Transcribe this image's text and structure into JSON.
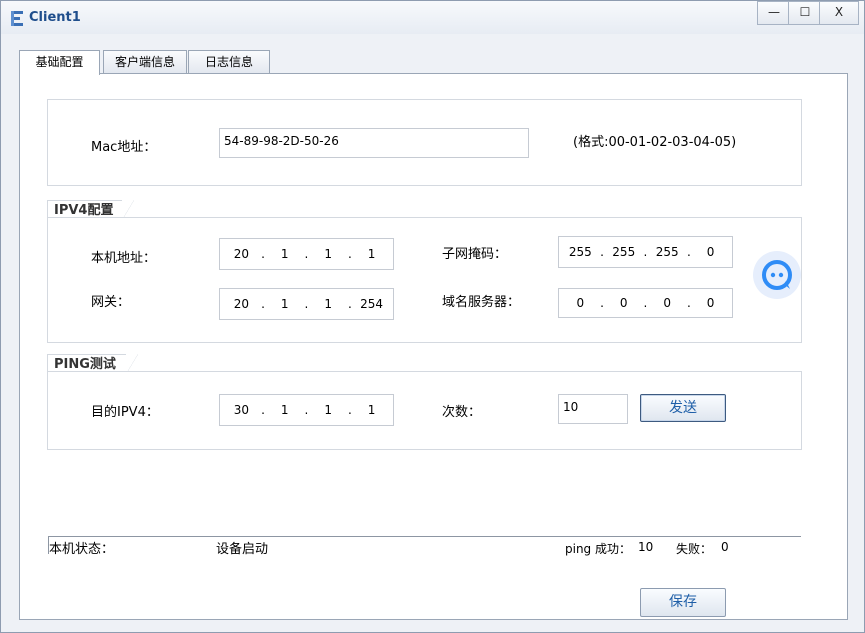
{
  "window": {
    "title": "Client1",
    "minimize": "—",
    "maximize": "☐",
    "close": "X"
  },
  "tabs": [
    "基础配置",
    "客户端信息",
    "日志信息"
  ],
  "mac": {
    "label": "Mac地址：",
    "value": "54-89-98-2D-50-26",
    "hint": "(格式:00-01-02-03-04-05)"
  },
  "ipv4": {
    "group_title": "IPV4配置",
    "host_label": "本机地址：",
    "host_ip": [
      "20",
      "1",
      "1",
      "1"
    ],
    "mask_label": "子网掩码：",
    "mask_ip": [
      "255",
      "255",
      "255",
      "0"
    ],
    "gw_label": "网关：",
    "gw_ip": [
      "20",
      "1",
      "1",
      "254"
    ],
    "dns_label": "域名服务器：",
    "dns_ip": [
      "0",
      "0",
      "0",
      "0"
    ]
  },
  "ping": {
    "group_title": "PING测试",
    "dest_label": "目的IPV4：",
    "dest_ip": [
      "30",
      "1",
      "1",
      "1"
    ],
    "count_label": "次数：",
    "count_value": "10",
    "send_label": "发送"
  },
  "status": {
    "label": "本机状态：",
    "value": "设备启动",
    "ping_success_label": "ping 成功：",
    "ping_success": "10",
    "fail_label": "失败：",
    "fail_value": "0"
  },
  "save_label": "保存",
  "colors": {
    "accent": "#1f5fa8",
    "chat_icon": "#2f8cf6"
  }
}
